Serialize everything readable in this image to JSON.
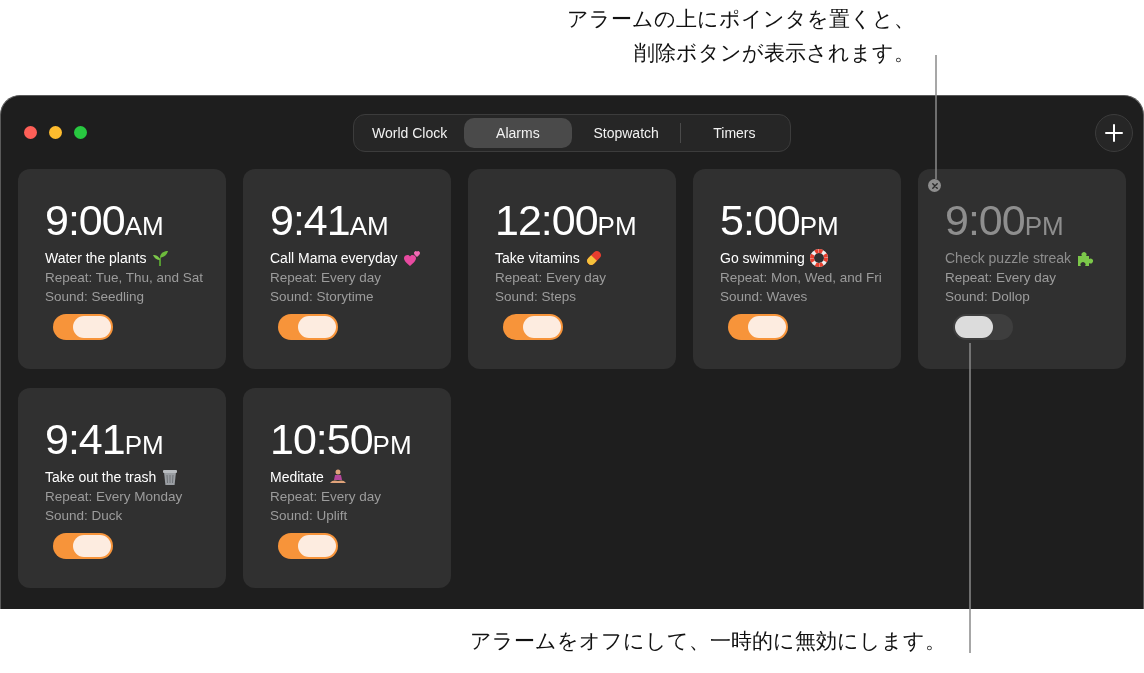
{
  "callouts": {
    "top": [
      "アラームの上にポインタを置くと、",
      "削除ボタンが表示されます。"
    ],
    "bottom": "アラームをオフにして、一時的に無効にします。"
  },
  "tabs": [
    {
      "label": "World Clock",
      "selected": false
    },
    {
      "label": "Alarms",
      "selected": true
    },
    {
      "label": "Stopwatch",
      "selected": false
    },
    {
      "label": "Timers",
      "selected": false
    }
  ],
  "alarms": [
    {
      "time": "9:00",
      "period": "AM",
      "label": "Water the plants",
      "repeat": "Repeat: Tue, Thu, and Sat",
      "sound": "Sound: Seedling",
      "on": true,
      "delete_shown": false
    },
    {
      "time": "9:41",
      "period": "AM",
      "label": "Call Mama everyday",
      "repeat": "Repeat: Every day",
      "sound": "Sound: Storytime",
      "on": true,
      "delete_shown": false
    },
    {
      "time": "12:00",
      "period": "PM",
      "label": "Take vitamins",
      "repeat": "Repeat: Every day",
      "sound": "Sound: Steps",
      "on": true,
      "delete_shown": false
    },
    {
      "time": "5:00",
      "period": "PM",
      "label": "Go swimming",
      "repeat": "Repeat: Mon, Wed, and Fri",
      "sound": "Sound: Waves",
      "on": true,
      "delete_shown": false
    },
    {
      "time": "9:00",
      "period": "PM",
      "label": "Check puzzle streak",
      "repeat": "Repeat: Every day",
      "sound": "Sound: Dollop",
      "on": false,
      "delete_shown": true
    },
    {
      "time": "9:41",
      "period": "PM",
      "label": "Take out the trash",
      "repeat": "Repeat: Every Monday",
      "sound": "Sound: Duck",
      "on": true,
      "delete_shown": false
    },
    {
      "time": "10:50",
      "period": "PM",
      "label": "Meditate",
      "repeat": "Repeat: Every day",
      "sound": "Sound: Uplift",
      "on": true,
      "delete_shown": false
    }
  ]
}
